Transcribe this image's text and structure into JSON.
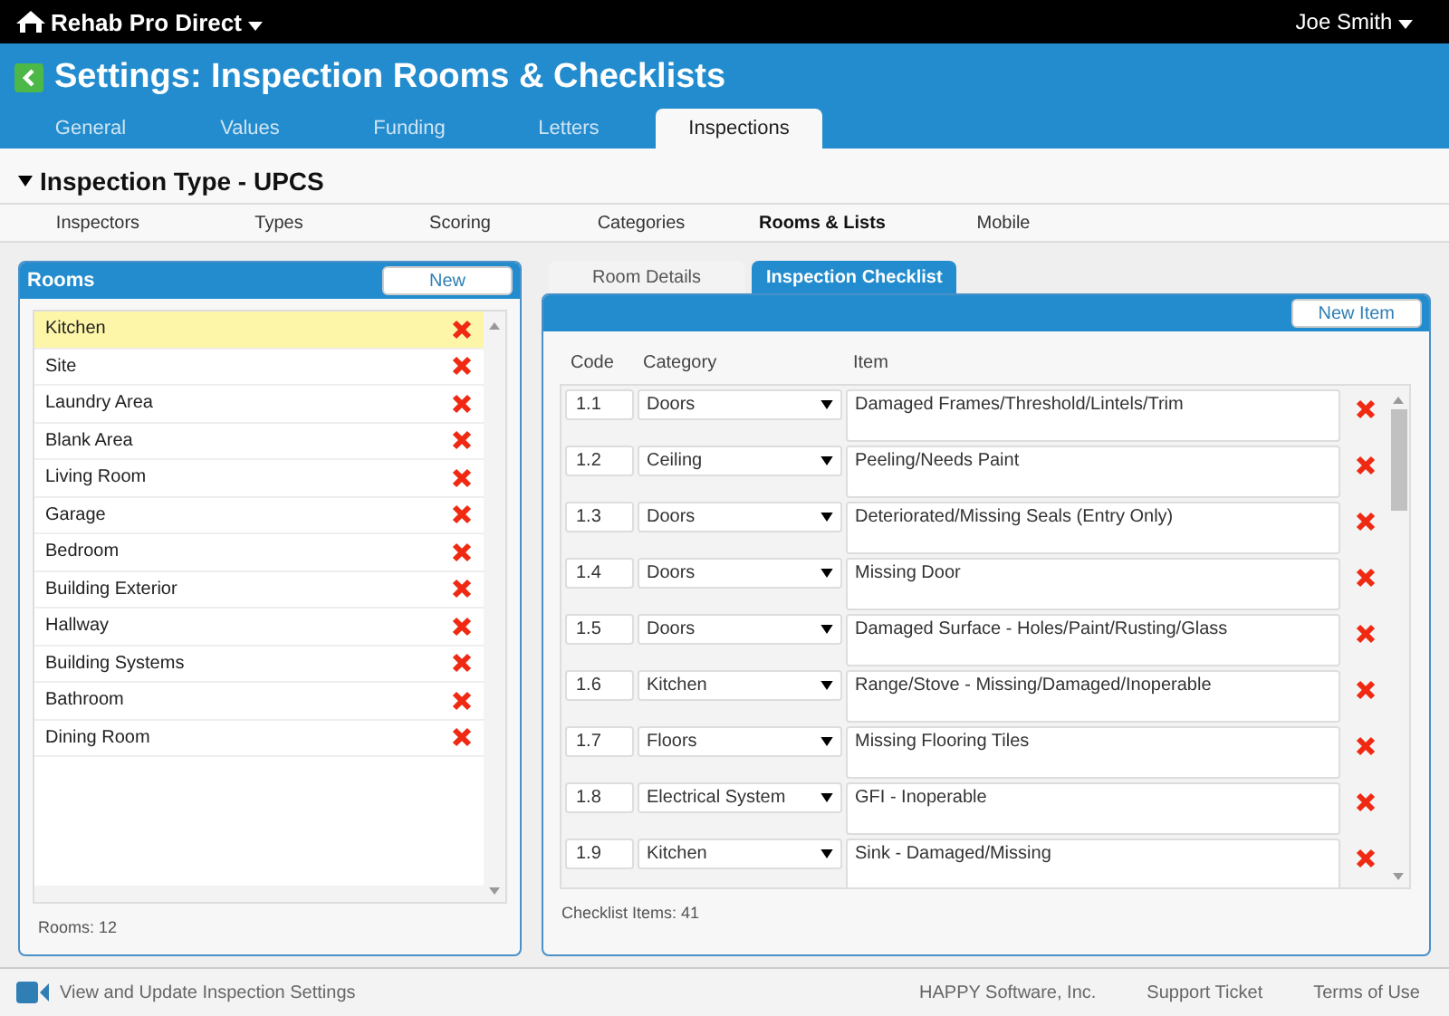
{
  "app": {
    "name": "Rehab Pro Direct",
    "user": "Joe Smith"
  },
  "page": {
    "title": "Settings: Inspection Rooms & Checklists"
  },
  "tabs": [
    {
      "label": "General",
      "selected": false
    },
    {
      "label": "Values",
      "selected": false
    },
    {
      "label": "Funding",
      "selected": false
    },
    {
      "label": "Letters",
      "selected": false
    },
    {
      "label": "Inspections",
      "selected": true
    }
  ],
  "section": {
    "title": "Inspection Type - UPCS",
    "expanded": true
  },
  "subtabs": [
    {
      "label": "Inspectors",
      "selected": false
    },
    {
      "label": "Types",
      "selected": false
    },
    {
      "label": "Scoring",
      "selected": false
    },
    {
      "label": "Categories",
      "selected": false
    },
    {
      "label": "Rooms & Lists",
      "selected": true
    },
    {
      "label": "Mobile",
      "selected": false
    }
  ],
  "rooms": {
    "title": "Rooms",
    "new_button": "New",
    "footer": "Rooms: 12",
    "items": [
      {
        "name": "Kitchen",
        "selected": true
      },
      {
        "name": "Site",
        "selected": false
      },
      {
        "name": "Laundry Area",
        "selected": false
      },
      {
        "name": "Blank Area",
        "selected": false
      },
      {
        "name": "Living Room",
        "selected": false
      },
      {
        "name": "Garage",
        "selected": false
      },
      {
        "name": "Bedroom",
        "selected": false
      },
      {
        "name": "Building Exterior",
        "selected": false
      },
      {
        "name": "Hallway",
        "selected": false
      },
      {
        "name": "Building Systems",
        "selected": false
      },
      {
        "name": "Bathroom",
        "selected": false
      },
      {
        "name": "Dining Room",
        "selected": false
      }
    ]
  },
  "checklist": {
    "tabs": [
      {
        "label": "Room Details",
        "selected": false
      },
      {
        "label": "Inspection Checklist",
        "selected": true
      }
    ],
    "new_button": "New Item",
    "columns": [
      "Code",
      "Category",
      "Item"
    ],
    "footer": "Checklist Items: 41",
    "rows": [
      {
        "code": "1.1",
        "category": "Doors",
        "item": "Damaged Frames/Threshold/Lintels/Trim"
      },
      {
        "code": "1.2",
        "category": "Ceiling",
        "item": "Peeling/Needs Paint"
      },
      {
        "code": "1.3",
        "category": "Doors",
        "item": "Deteriorated/Missing Seals (Entry Only)"
      },
      {
        "code": "1.4",
        "category": "Doors",
        "item": "Missing Door"
      },
      {
        "code": "1.5",
        "category": "Doors",
        "item": "Damaged Surface - Holes/Paint/Rusting/Glass"
      },
      {
        "code": "1.6",
        "category": "Kitchen",
        "item": "Range/Stove - Missing/Damaged/Inoperable"
      },
      {
        "code": "1.7",
        "category": "Floors",
        "item": "Missing Flooring Tiles"
      },
      {
        "code": "1.8",
        "category": "Electrical System",
        "item": "GFI - Inoperable"
      },
      {
        "code": "1.9",
        "category": "Kitchen",
        "item": "Sink - Damaged/Missing"
      }
    ]
  },
  "footer": {
    "help_link": "View and Update Inspection Settings",
    "links": [
      "HAPPY Software, Inc.",
      "Support Ticket",
      "Terms of Use"
    ]
  }
}
